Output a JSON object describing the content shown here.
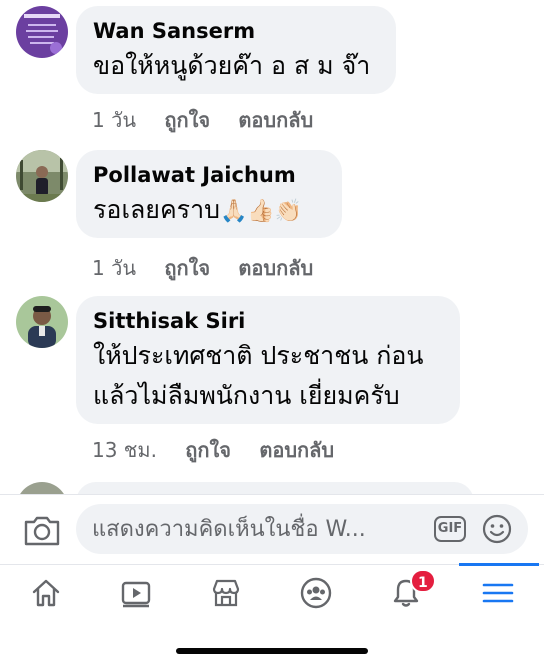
{
  "comments": [
    {
      "author": "Wan Sanserm",
      "text": "ขอให้หนูด้วยค๊า อ ส ม จ๊า",
      "time": "1 วัน",
      "like_label": "ถูกใจ",
      "reply_label": "ตอบกลับ",
      "avatar_icon": "purple-poster-avatar"
    },
    {
      "author": "Pollawat Jaichum",
      "text": "รอเลยคราบ",
      "emojis": "🙏🏻👍🏻👏🏻",
      "time": "1 วัน",
      "like_label": "ถูกใจ",
      "reply_label": "ตอบกลับ",
      "avatar_icon": "forest-person-avatar"
    },
    {
      "author": "Sitthisak Siri",
      "text_line1": "ให้ประเทศชาติ ประชาชน ก่อน",
      "text_line2": "แล้วไม่ลืมพนักงาน เยี่ยมครับ",
      "time": "13 ชม.",
      "like_label": "ถูกใจ",
      "reply_label": "ตอบกลับ",
      "avatar_icon": "man-portrait-avatar"
    }
  ],
  "composer": {
    "placeholder": "แสดงความคิดเห็นในชื่อ W...",
    "gif_label": "GIF",
    "camera_icon": "camera-icon",
    "emoji_icon": "smiley-icon"
  },
  "tabbar": {
    "items": [
      "home-icon",
      "video-icon",
      "marketplace-icon",
      "groups-icon",
      "notifications-icon",
      "menu-icon"
    ],
    "notification_count": "1",
    "active": "menu-icon",
    "accent": "#1877f2",
    "badge_color": "#e41e3f"
  }
}
